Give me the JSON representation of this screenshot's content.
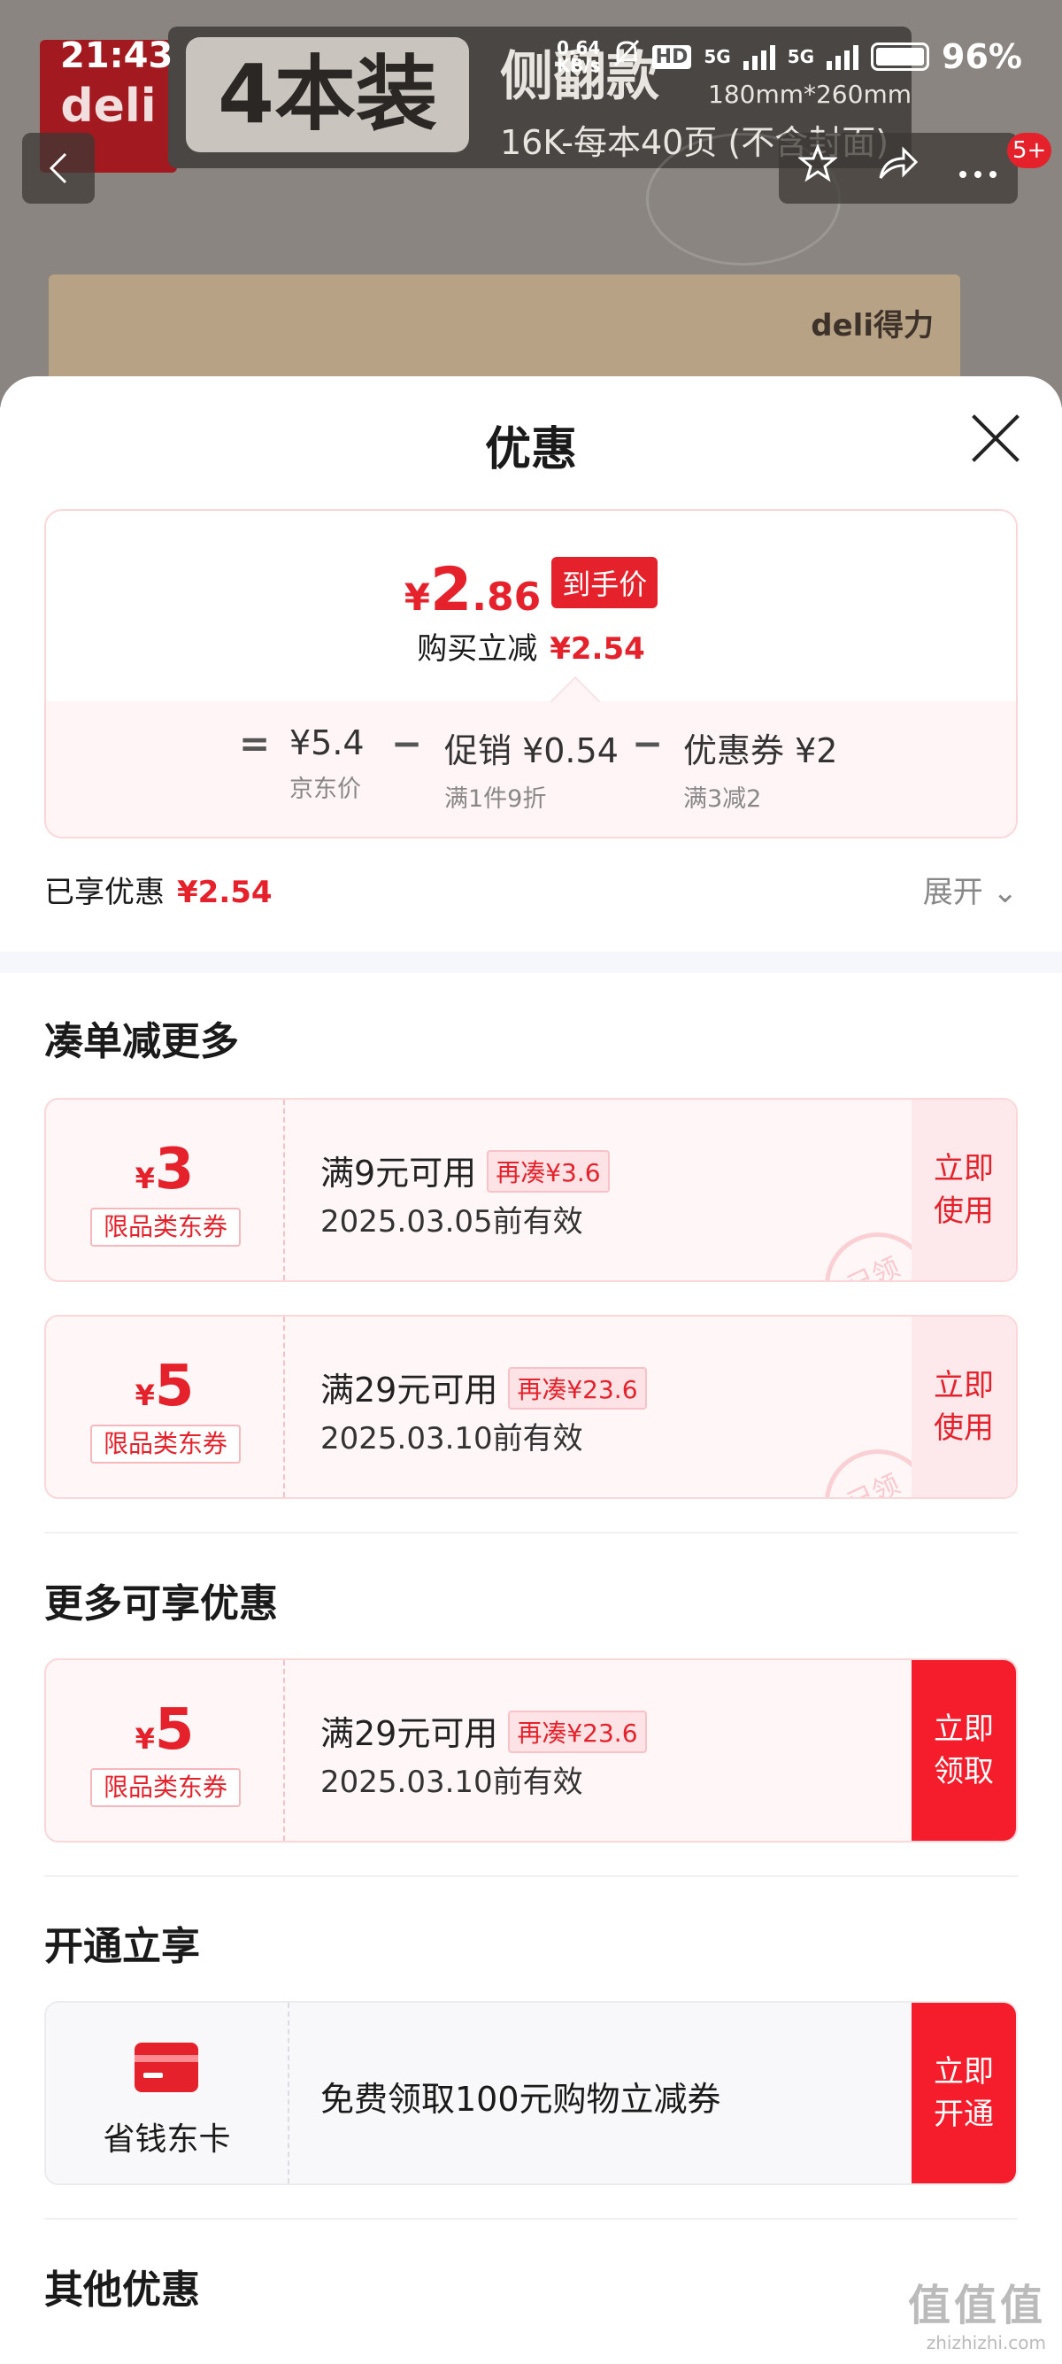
{
  "status_bar": {
    "time": "21:43",
    "speed": "0.64\nKB/s",
    "hd": "HD",
    "net1": "5G",
    "net2": "5G",
    "battery": "96%"
  },
  "background": {
    "logo": "deli",
    "banner_big": "4本装",
    "banner_side": "侧翻款",
    "banner_size": "180mm*260mm",
    "banner_sub": "16K-每本40页 (不含封面)",
    "box_brand": "deli得力"
  },
  "nav": {
    "badge": "5+"
  },
  "sheet": {
    "title": "优惠",
    "price": {
      "currency": "¥",
      "integer": "2",
      "decimal": ".86",
      "tag": "到手价",
      "reduce_label": "购买立减",
      "reduce_amount": "¥2.54"
    },
    "formula": {
      "eq": "=",
      "jd_price": "¥5.4",
      "jd_label": "京东价",
      "minus1": "−",
      "promo": "促销 ¥0.54",
      "promo_label": "满1件9折",
      "minus2": "−",
      "coupon": "优惠券 ¥2",
      "coupon_label": "满3减2"
    },
    "enjoyed_label": "已享优惠",
    "enjoyed_amount": "¥2.54",
    "expand": "展开 ⌄",
    "section1": "凑单减更多",
    "coupons1": [
      {
        "currency": "¥",
        "value": "3",
        "kind": "限品类东券",
        "cond": "满9元可用",
        "extra": "再凑¥3.6",
        "exp": "2025.03.05前有效",
        "action": "立即\n使用",
        "stamp": "已领"
      },
      {
        "currency": "¥",
        "value": "5",
        "kind": "限品类东券",
        "cond": "满29元可用",
        "extra": "再凑¥23.6",
        "exp": "2025.03.10前有效",
        "action": "立即\n使用",
        "stamp": "已领"
      }
    ],
    "section2": "更多可享优惠",
    "coupons2": [
      {
        "currency": "¥",
        "value": "5",
        "kind": "限品类东券",
        "cond": "满29元可用",
        "extra": "再凑¥23.6",
        "exp": "2025.03.10前有效",
        "action": "立即\n领取"
      }
    ],
    "section3": "开通立享",
    "card": {
      "name": "省钱东卡",
      "desc": "免费领取100元购物立减券",
      "action": "立即\n开通"
    },
    "section4": "其他优惠"
  },
  "watermark": {
    "big": "值值值",
    "small": "zhizhizhi.com"
  },
  "colors": {
    "accent": "#e5222b",
    "button": "#f51d2c"
  }
}
